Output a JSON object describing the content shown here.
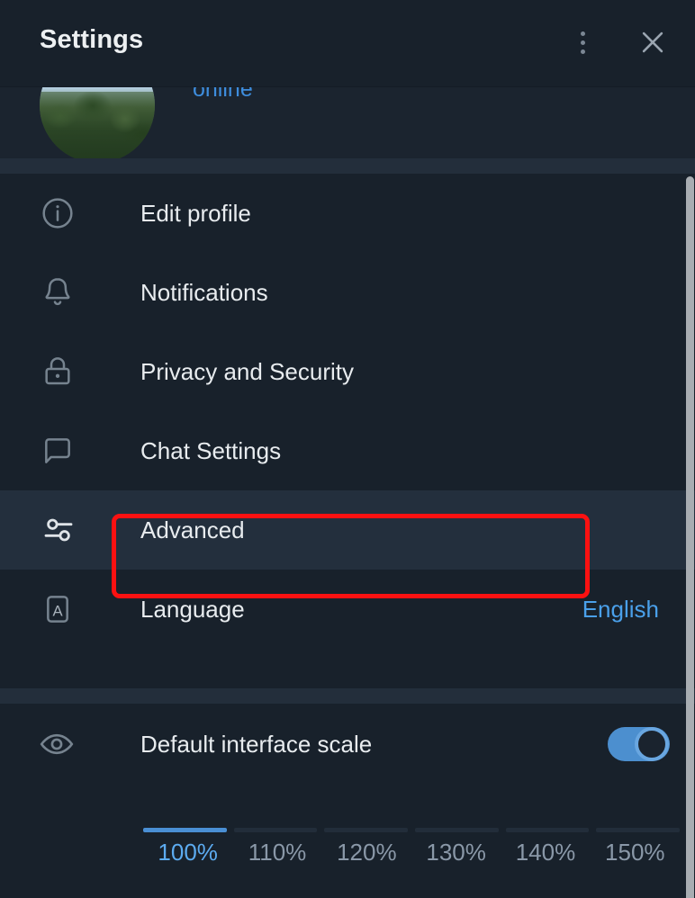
{
  "header": {
    "title": "Settings",
    "menu_icon": "more-vertical-icon",
    "close_icon": "close-icon"
  },
  "profile": {
    "status": "online",
    "avatar_alt": "user-avatar-photo"
  },
  "menu": {
    "items": [
      {
        "label": "Edit profile",
        "icon": "info-circle-icon",
        "value": "",
        "active": false
      },
      {
        "label": "Notifications",
        "icon": "bell-icon",
        "value": "",
        "active": false
      },
      {
        "label": "Privacy and Security",
        "icon": "lock-icon",
        "value": "",
        "active": false
      },
      {
        "label": "Chat Settings",
        "icon": "chat-bubble-icon",
        "value": "",
        "active": false
      },
      {
        "label": "Advanced",
        "icon": "sliders-icon",
        "value": "",
        "active": true
      },
      {
        "label": "Language",
        "icon": "letter-a-icon",
        "value": "English",
        "active": false
      }
    ]
  },
  "scale": {
    "label": "Default interface scale",
    "icon": "eye-icon",
    "toggle_on": true,
    "selected": "100%",
    "options": [
      "100%",
      "110%",
      "120%",
      "130%",
      "140%",
      "150%"
    ]
  },
  "colors": {
    "background": "#18212b",
    "divider": "#232e3b",
    "row_active": "#232f3d",
    "accent_blue": "#4aa0ea",
    "annotation_red": "#fb1111",
    "text_primary": "#e8ecef",
    "text_muted": "#8a98a8"
  }
}
